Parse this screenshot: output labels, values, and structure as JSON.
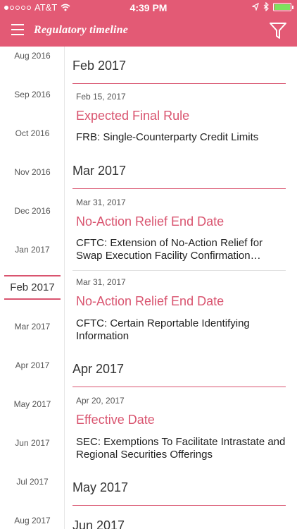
{
  "status_bar": {
    "carrier": "AT&T",
    "time": "4:39 PM"
  },
  "nav": {
    "title": "Regulatory timeline"
  },
  "sidebar": {
    "months": [
      "Aug 2016",
      "Sep 2016",
      "Oct 2016",
      "Nov 2016",
      "Dec 2016",
      "Jan 2017",
      "Feb 2017",
      "Mar 2017",
      "Apr 2017",
      "May 2017",
      "Jun 2017",
      "Jul 2017",
      "Aug 2017"
    ],
    "active": "Feb 2017"
  },
  "timeline": {
    "groups": [
      {
        "month": "Feb 2017",
        "entries": [
          {
            "date": "Feb 15, 2017",
            "title": "Expected Final Rule",
            "desc": "FRB:  Single-Counterparty Credit Limits"
          }
        ]
      },
      {
        "month": "Mar 2017",
        "entries": [
          {
            "date": "Mar 31, 2017",
            "title": "No-Action Relief End Date",
            "desc": "CFTC:  Extension of No-Action Relief for Swap Execution Facility Confirmation…"
          },
          {
            "date": "Mar 31, 2017",
            "title": "No-Action Relief End Date",
            "desc": "CFTC:  Certain Reportable Identifying Information"
          }
        ]
      },
      {
        "month": "Apr 2017",
        "entries": [
          {
            "date": "Apr 20, 2017",
            "title": "Effective Date",
            "desc": "SEC:  Exemptions To Facilitate Intrastate and Regional Securities Offerings"
          }
        ]
      },
      {
        "month": "May 2017",
        "entries": []
      },
      {
        "month": "Jun 2017",
        "entries": []
      }
    ]
  },
  "colors": {
    "accent": "#e35a75",
    "title_pink": "#d9546f",
    "battery": "#7ce25e"
  }
}
